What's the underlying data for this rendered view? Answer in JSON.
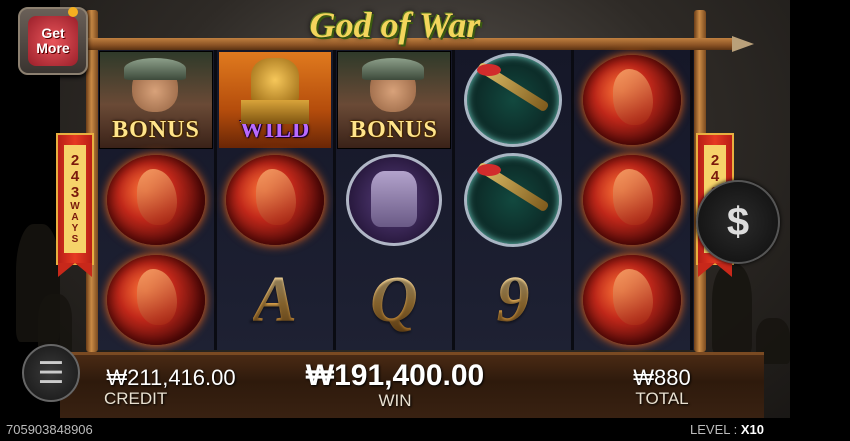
{
  "game": {
    "title": "God of War",
    "get_more": {
      "line1": "Get",
      "line2": "More"
    },
    "ways": {
      "number": [
        "2",
        "4",
        "3"
      ],
      "word": [
        "W",
        "A",
        "Y",
        "S"
      ]
    },
    "currency_symbol": "$"
  },
  "reels": [
    [
      {
        "symbol": "general",
        "label": "BONUS"
      },
      {
        "symbol": "red-horse",
        "label": ""
      },
      {
        "symbol": "red-horse",
        "label": ""
      }
    ],
    [
      {
        "symbol": "golden-seal",
        "label": "WILD"
      },
      {
        "symbol": "red-horse",
        "label": ""
      },
      {
        "symbol": "letter",
        "label": "A"
      }
    ],
    [
      {
        "symbol": "general",
        "label": "BONUS"
      },
      {
        "symbol": "armor",
        "label": ""
      },
      {
        "symbol": "letter",
        "label": "Q"
      }
    ],
    [
      {
        "symbol": "blade",
        "label": ""
      },
      {
        "symbol": "blade",
        "label": ""
      },
      {
        "symbol": "letter",
        "label": "9"
      }
    ],
    [
      {
        "symbol": "red-horse",
        "label": ""
      },
      {
        "symbol": "red-horse",
        "label": ""
      },
      {
        "symbol": "red-horse",
        "label": ""
      }
    ]
  ],
  "stats": {
    "credit": {
      "value": "₩211,416.00",
      "label": "CREDIT"
    },
    "win": {
      "value": "₩191,400.00",
      "label": "WIN"
    },
    "total": {
      "value": "₩880",
      "label": "TOTAL"
    }
  },
  "footer": {
    "session_id": "705903848906",
    "level_label": "LEVEL :",
    "level_value": "X10"
  },
  "colors": {
    "banner_red": "#e63a22",
    "banner_gold": "#f6d36a",
    "title_gold": "#f3d55c"
  }
}
